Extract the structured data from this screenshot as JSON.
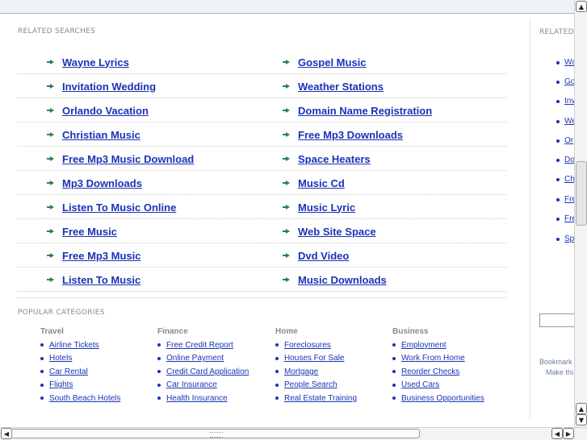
{
  "related": {
    "heading": "RELATED SEARCHES",
    "left": [
      "Wayne Lyrics",
      "Invitation Wedding",
      "Orlando Vacation",
      "Christian Music",
      "Free Mp3 Music Download",
      "Mp3 Downloads",
      "Listen To Music Online",
      "Free Music",
      "Free Mp3 Music",
      "Listen To Music"
    ],
    "right": [
      "Gospel Music",
      "Weather Stations",
      "Domain Name Registration",
      "Free Mp3 Downloads",
      "Space Heaters",
      "Music Cd",
      "Music Lyric",
      "Web Site Space",
      "Dvd Video",
      "Music Downloads"
    ]
  },
  "popular": {
    "heading": "POPULAR CATEGORIES",
    "columns": [
      {
        "title": "Travel",
        "items": [
          "Airline Tickets",
          "Hotels",
          "Car Rental",
          "Flights",
          "South Beach Hotels"
        ]
      },
      {
        "title": "Finance",
        "items": [
          "Free Credit Report",
          "Online Payment",
          "Credit Card Application",
          "Car Insurance",
          "Health Insurance"
        ]
      },
      {
        "title": "Home",
        "items": [
          "Foreclosures",
          "Houses For Sale",
          "Mortgage",
          "People Search",
          "Real Estate Training"
        ]
      },
      {
        "title": "Business",
        "items": [
          "Employment",
          "Work From Home",
          "Reorder Checks",
          "Used Cars",
          "Business Opportunities"
        ]
      }
    ]
  },
  "sidebar": {
    "heading": "RELATED",
    "items": [
      "Wa",
      "Go",
      "Inv",
      "We",
      "Or",
      "Do",
      "Ch",
      "Fre",
      "Fre",
      "Sp"
    ],
    "bookmark": "Bookmark",
    "make": "Make thi"
  },
  "scrollbars": {
    "up": "▲",
    "down": "▼",
    "left": "◀",
    "right": "▶"
  }
}
